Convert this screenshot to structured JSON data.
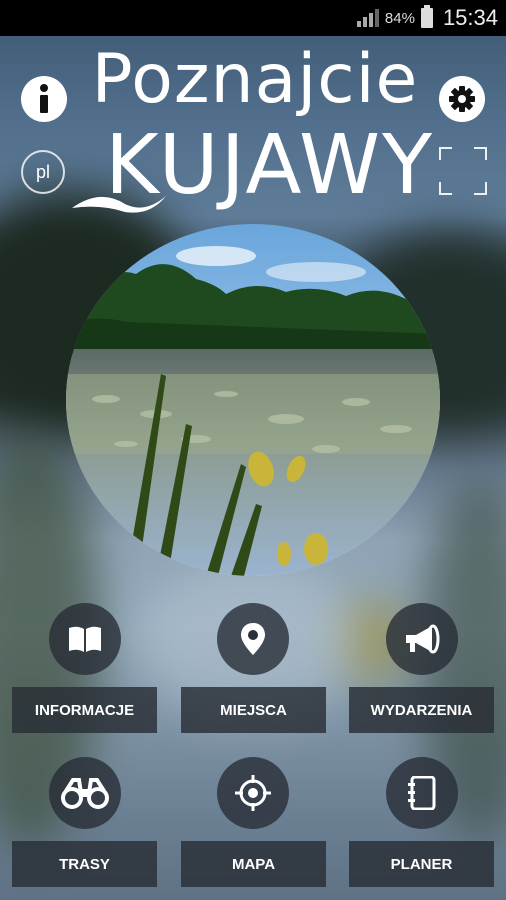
{
  "status_bar": {
    "battery": "84%",
    "time": "15:34"
  },
  "header": {
    "title_line1": "Poznajcie",
    "title_line2": "KUJAWY",
    "language": "pl"
  },
  "icons": {
    "info": "info-icon",
    "settings": "gear-icon",
    "fullscreen": "fullscreen-icon"
  },
  "menu": {
    "items": [
      {
        "label": "INFORMACJE",
        "icon": "book-icon"
      },
      {
        "label": "MIEJSCA",
        "icon": "map-pin-icon"
      },
      {
        "label": "WYDARZENIA",
        "icon": "megaphone-icon"
      },
      {
        "label": "TRASY",
        "icon": "binoculars-icon"
      },
      {
        "label": "MAPA",
        "icon": "crosshair-icon"
      },
      {
        "label": "PLANER",
        "icon": "notebook-icon"
      }
    ]
  }
}
